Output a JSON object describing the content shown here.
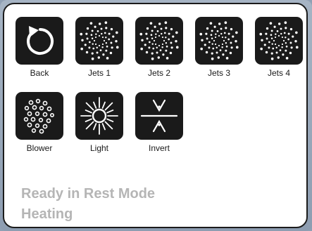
{
  "buttons": {
    "back": {
      "label": "Back",
      "icon": "back-arrow-icon"
    },
    "jets1": {
      "label": "Jets 1",
      "icon": "jets-swirl-icon"
    },
    "jets2": {
      "label": "Jets 2",
      "icon": "jets-swirl-icon"
    },
    "jets3": {
      "label": "Jets 3",
      "icon": "jets-swirl-icon"
    },
    "jets4": {
      "label": "Jets 4",
      "icon": "jets-swirl-icon"
    },
    "blower": {
      "label": "Blower",
      "icon": "blower-bubbles-icon"
    },
    "light": {
      "label": "Light",
      "icon": "light-sun-icon"
    },
    "invert": {
      "label": "Invert",
      "icon": "invert-icon"
    }
  },
  "status": {
    "line1": "Ready in Rest Mode",
    "line2": "Heating"
  },
  "colors": {
    "tile": "#1a1a1a",
    "icon": "#ffffff",
    "status_text": "#b5b5b5",
    "frame": "#8fa0b4"
  }
}
